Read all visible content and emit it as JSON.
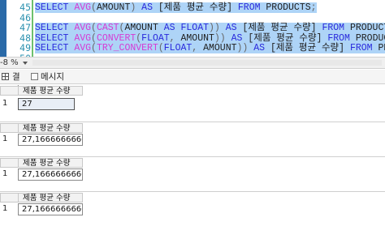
{
  "editor": {
    "lines": [
      {
        "num": "45",
        "selected": true,
        "parts": [
          {
            "t": "SELECT ",
            "c": "kw"
          },
          {
            "t": "AVG",
            "c": "fn"
          },
          {
            "t": "(",
            "c": "gy"
          },
          {
            "t": "AMOUNT",
            "c": "tx"
          },
          {
            "t": ") ",
            "c": "gy"
          },
          {
            "t": "AS ",
            "c": "kw"
          },
          {
            "t": "[제품 평균 수량] ",
            "c": "tx"
          },
          {
            "t": "FROM ",
            "c": "kw"
          },
          {
            "t": "PRODUCTS",
            "c": "tx"
          },
          {
            "t": ";",
            "c": "gy"
          }
        ]
      },
      {
        "num": "46",
        "selected": false,
        "parts": []
      },
      {
        "num": "47",
        "selected": true,
        "parts": [
          {
            "t": "SELECT ",
            "c": "kw"
          },
          {
            "t": "AVG",
            "c": "fn"
          },
          {
            "t": "(",
            "c": "gy"
          },
          {
            "t": "CAST",
            "c": "fn"
          },
          {
            "t": "(",
            "c": "gy"
          },
          {
            "t": "AMOUNT ",
            "c": "tx"
          },
          {
            "t": "AS ",
            "c": "kw"
          },
          {
            "t": "FLOAT",
            "c": "kw"
          },
          {
            "t": ")) ",
            "c": "gy"
          },
          {
            "t": "AS ",
            "c": "kw"
          },
          {
            "t": "[제품 평균 수량] ",
            "c": "tx"
          },
          {
            "t": "FROM ",
            "c": "kw"
          },
          {
            "t": "PRODUCTS",
            "c": "tx"
          },
          {
            "t": ";",
            "c": "gy"
          }
        ]
      },
      {
        "num": "48",
        "selected": true,
        "parts": [
          {
            "t": "SELECT ",
            "c": "kw"
          },
          {
            "t": "AVG",
            "c": "fn"
          },
          {
            "t": "(",
            "c": "gy"
          },
          {
            "t": "CONVERT",
            "c": "fn"
          },
          {
            "t": "(",
            "c": "gy"
          },
          {
            "t": "FLOAT",
            "c": "kw"
          },
          {
            "t": ", ",
            "c": "gy"
          },
          {
            "t": "AMOUNT",
            "c": "tx"
          },
          {
            "t": ")) ",
            "c": "gy"
          },
          {
            "t": "AS ",
            "c": "kw"
          },
          {
            "t": "[제품 평균 수량] ",
            "c": "tx"
          },
          {
            "t": "FROM ",
            "c": "kw"
          },
          {
            "t": "PRODUCTS",
            "c": "tx"
          },
          {
            "t": ";",
            "c": "gy"
          }
        ]
      },
      {
        "num": "49",
        "selected": true,
        "parts": [
          {
            "t": "SELECT ",
            "c": "kw"
          },
          {
            "t": "AVG",
            "c": "fn"
          },
          {
            "t": "(",
            "c": "gy"
          },
          {
            "t": "TRY_CONVERT",
            "c": "fn"
          },
          {
            "t": "(",
            "c": "gy"
          },
          {
            "t": "FLOAT",
            "c": "kw"
          },
          {
            "t": ", ",
            "c": "gy"
          },
          {
            "t": "AMOUNT",
            "c": "tx"
          },
          {
            "t": ")) ",
            "c": "gy"
          },
          {
            "t": "AS ",
            "c": "kw"
          },
          {
            "t": "[제품 평균 수량] ",
            "c": "tx"
          },
          {
            "t": "FROM ",
            "c": "kw"
          },
          {
            "t": "PRODUCTS",
            "c": "tx"
          },
          {
            "t": ";",
            "c": "gy"
          }
        ]
      },
      {
        "num": "50",
        "selected": false,
        "parts": []
      }
    ]
  },
  "zoom": {
    "label": "-8 %"
  },
  "tabs": {
    "results": "결과",
    "messages": "메시지"
  },
  "results": [
    {
      "header": "",
      "rows": [
        {
          "num": "1",
          "value": "27"
        }
      ]
    },
    {
      "header": "제품 평균 수량",
      "rows": [
        {
          "num": "1",
          "value": "27,1666666666667"
        }
      ]
    },
    {
      "header": "제품 평균 수량",
      "rows": [
        {
          "num": "1",
          "value": "27,1666666666667"
        }
      ]
    },
    {
      "header": "제품 평균 수량",
      "rows": [
        {
          "num": "1",
          "value": "27,1666666666667"
        }
      ]
    }
  ],
  "first_result_header": "제품 평균 수량",
  "colors": {
    "selection": "#aed4f7",
    "keyword": "#2a2adc",
    "function": "#d63ad3",
    "line_number": "#2b91af"
  }
}
